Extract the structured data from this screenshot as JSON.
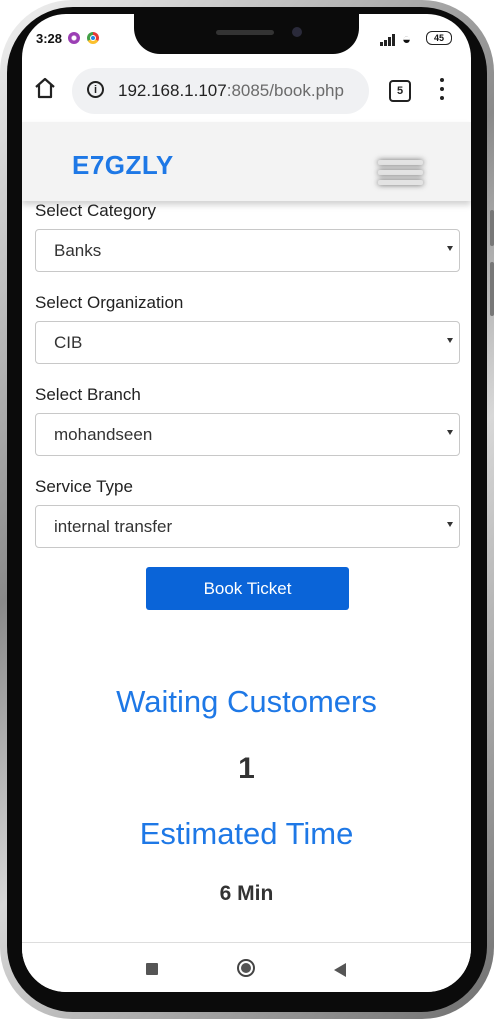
{
  "status_bar": {
    "time": "3:28",
    "battery": "45"
  },
  "browser": {
    "url_host": "192.168.1.107",
    "url_rest": ":8085/book.php",
    "tab_count": "5"
  },
  "header": {
    "brand": "E7GZLY"
  },
  "form": {
    "category": {
      "label": "Select Category",
      "value": "Banks"
    },
    "organization": {
      "label": "Select Organization",
      "value": "CIB"
    },
    "branch": {
      "label": "Select Branch",
      "value": "mohandseen"
    },
    "service": {
      "label": "Service Type",
      "value": "internal transfer"
    },
    "book_button": "Book Ticket"
  },
  "stats": {
    "waiting_title": "Waiting Customers",
    "waiting_value": "1",
    "estimated_title": "Estimated Time",
    "estimated_value": "6 Min"
  },
  "colors": {
    "brand_blue": "#1e78e6",
    "button_blue": "#0a64d8"
  },
  "icons": {
    "home": "home-icon",
    "info": "info-icon",
    "tabs": "tabs-icon",
    "more": "more-vert-icon",
    "menu": "hamburger-menu-icon",
    "nav_recents": "square-icon",
    "nav_home": "circle-icon",
    "nav_back": "triangle-back-icon"
  }
}
